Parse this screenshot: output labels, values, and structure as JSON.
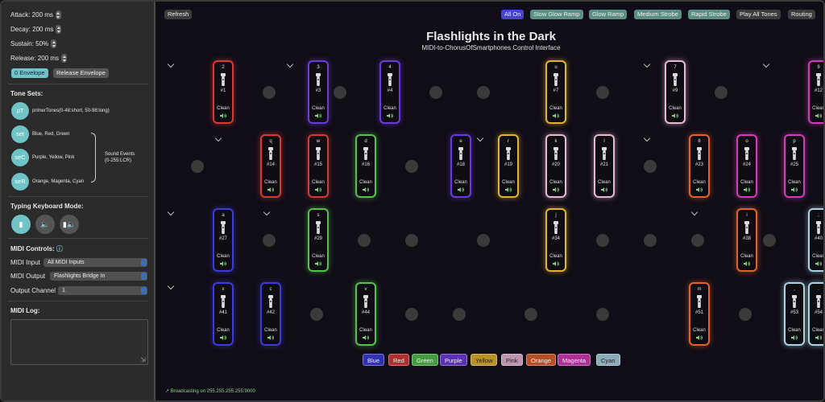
{
  "sidebar": {
    "attack": "Attack: 200 ms",
    "decay": "Decay: 200 ms",
    "sustain": "Sustain: 50%",
    "release": "Release: 200 ms",
    "envelope_btn": "0 Envelope",
    "release_env_btn": "Release Envelope",
    "tone_sets_title": "Tone Sets:",
    "tone_sets": [
      {
        "abbr": "pT",
        "label": "primerTones(0-48:short, 50-98:long)"
      },
      {
        "abbr": "set",
        "label": "Blue, Red, Green"
      },
      {
        "abbr": "seC",
        "label": "Purple, Yellow, Pink"
      },
      {
        "abbr": "seR",
        "label": "Orange, Magenta, Cyan"
      }
    ],
    "sound_events": "Sound Events",
    "sound_events_range": "(0-255:LCR)",
    "typing_title": "Typing Keyboard Mode:",
    "midi_controls_title": "MIDI Controls:",
    "midi_input_label": "MIDI Input",
    "midi_input_value": "All MIDI Inputs",
    "midi_output_label": "MIDI Output",
    "midi_output_value": "Flashlights Bridge In",
    "output_channel_label": "Output Channel",
    "output_channel_value": "1",
    "midi_log_title": "MIDI Log:"
  },
  "toolbar": {
    "refresh": "Refresh",
    "all_on": "All On",
    "slow_glow": "Slow Glow Ramp",
    "glow_ramp": "Glow Ramp",
    "medium_strobe": "Medium Strobe",
    "rapid_strobe": "Rapid Strobe",
    "play_all": "Play All Tones",
    "routing": "Routing"
  },
  "header": {
    "title": "Flashlights in the Dark",
    "subtitle": "MIDI-to-ChorusOfSmartphones Control Interface"
  },
  "clean_label": "Clean",
  "colors": {
    "Blue": "#3b3bd6",
    "Red": "#d63a34",
    "Green": "#52c04a",
    "Purple": "#6b3bd9",
    "Yellow": "#e2b32c",
    "Pink": "#e6b9d3",
    "Orange": "#e0632c",
    "Magenta": "#d33bb8",
    "Cyan": "#a9d3e0"
  },
  "cards": [
    {
      "key": "2",
      "num": "#1",
      "color": "Red"
    },
    {
      "key": "3",
      "num": "#3",
      "color": "Purple"
    },
    {
      "key": "4",
      "num": "#4",
      "color": "Purple"
    },
    {
      "key": "u",
      "num": "#7",
      "color": "Yellow"
    },
    {
      "key": "7",
      "num": "#9",
      "color": "Pink"
    },
    {
      "key": "9",
      "num": "#12",
      "color": "Magenta"
    },
    {
      "key": "q",
      "num": "#14",
      "color": "Red"
    },
    {
      "key": "w",
      "num": "#15",
      "color": "Red"
    },
    {
      "key": "d",
      "num": "#16",
      "color": "Green"
    },
    {
      "key": "e",
      "num": "#18",
      "color": "Purple"
    },
    {
      "key": "r",
      "num": "#19",
      "color": "Yellow"
    },
    {
      "key": "k",
      "num": "#20",
      "color": "Pink"
    },
    {
      "key": "l",
      "num": "#21",
      "color": "Pink"
    },
    {
      "key": "8",
      "num": "#23",
      "color": "Orange"
    },
    {
      "key": "o",
      "num": "#24",
      "color": "Magenta"
    },
    {
      "key": "p",
      "num": "#25",
      "color": "Magenta"
    },
    {
      "key": "a",
      "num": "#27",
      "color": "Blue"
    },
    {
      "key": "s",
      "num": "#29",
      "color": "Green"
    },
    {
      "key": "j",
      "num": "#34",
      "color": "Yellow"
    },
    {
      "key": "i",
      "num": "#38",
      "color": "Orange"
    },
    {
      "key": ";",
      "num": "#40",
      "color": "Cyan"
    },
    {
      "key": "x",
      "num": "#41",
      "color": "Blue"
    },
    {
      "key": "c",
      "num": "#42",
      "color": "Blue"
    },
    {
      "key": "v",
      "num": "#44",
      "color": "Green"
    },
    {
      "key": "m",
      "num": "#51",
      "color": "Orange"
    },
    {
      "key": ",",
      "num": "#53",
      "color": "Cyan"
    },
    {
      "key": ".",
      "num": "#54",
      "color": "Cyan"
    }
  ],
  "legend": [
    "Blue",
    "Red",
    "Green",
    "Purple",
    "Yellow",
    "Pink",
    "Orange",
    "Magenta",
    "Cyan"
  ],
  "status": "Broadcasting on 255.255.255.255:9000"
}
